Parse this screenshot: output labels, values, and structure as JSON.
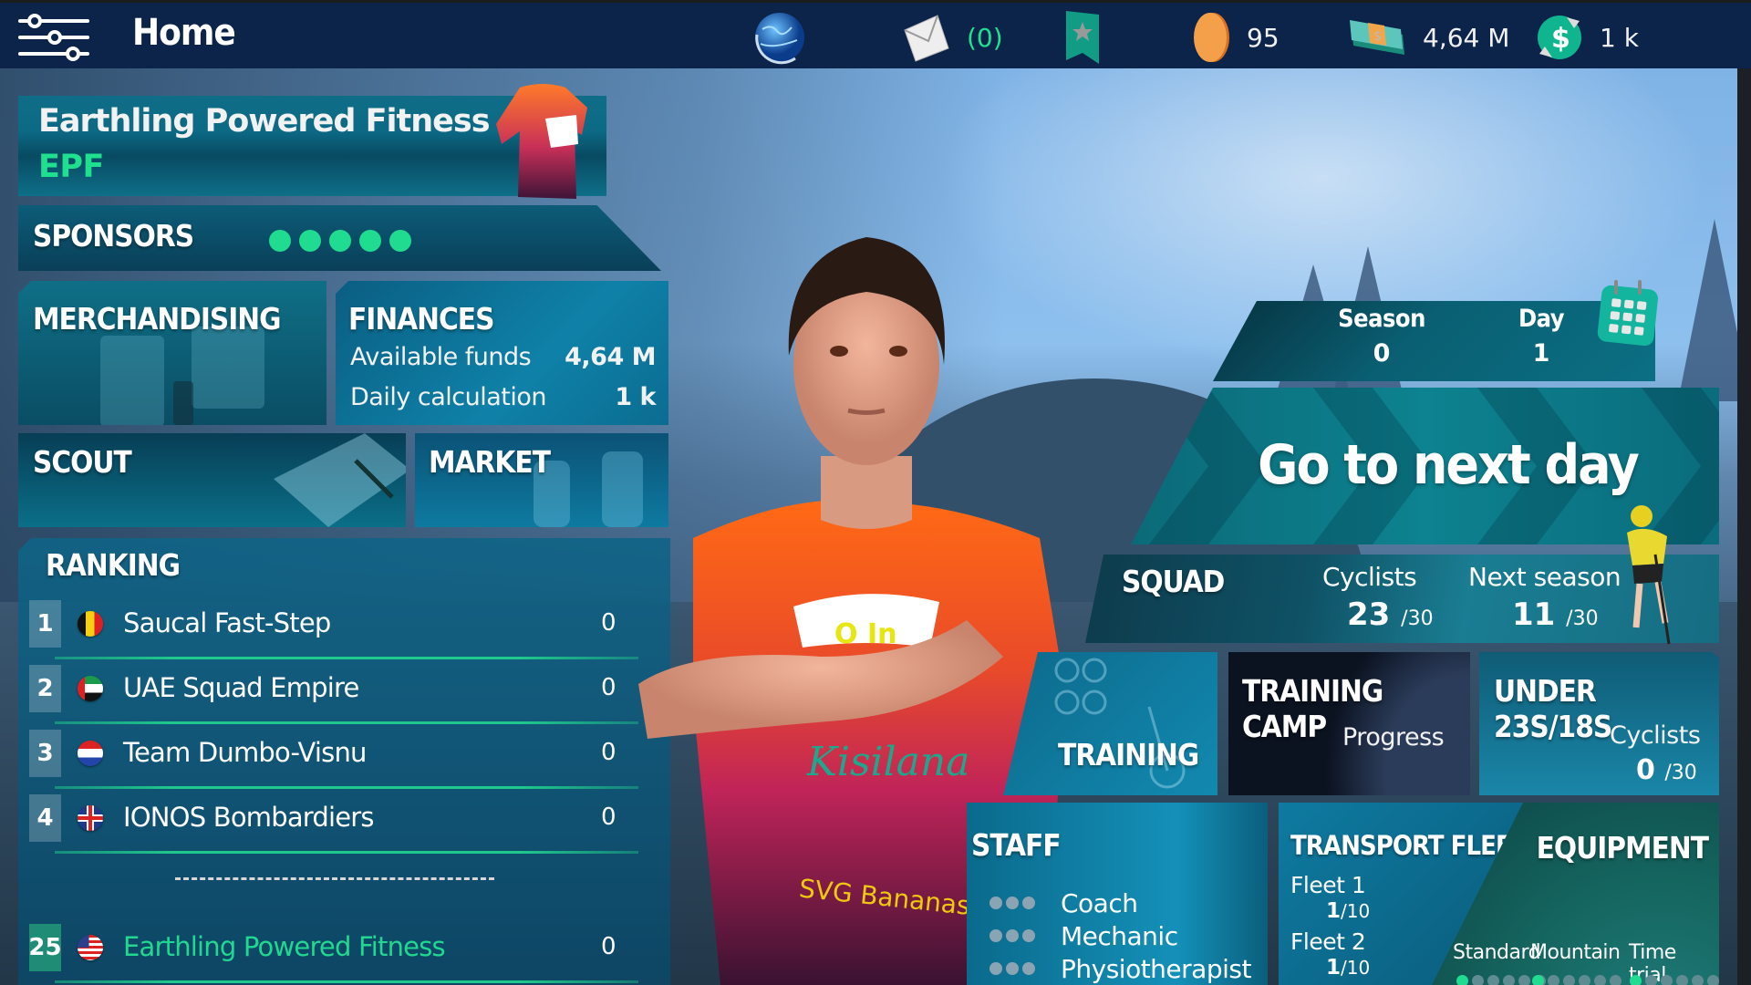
{
  "topbar": {
    "title": "Home",
    "messages_count": "(0)",
    "coins": "95",
    "funds": "4,64 M",
    "daily_income": "1 k",
    "icons": [
      "menu-sliders-icon",
      "globe-icon",
      "envelope-icon",
      "bookmark-star-icon",
      "coin-icon",
      "cash-icon",
      "dollar-exchange-icon"
    ]
  },
  "team": {
    "name": "Earthling Powered Fitness",
    "abbr": "EPF"
  },
  "sponsors": {
    "title": "SPONSORS",
    "rating": 5,
    "max_rating": 5
  },
  "merchandising": {
    "title": "MERCHANDISING"
  },
  "finances": {
    "title": "FINANCES",
    "rows": [
      {
        "label": "Available funds",
        "value": "4,64 M"
      },
      {
        "label": "Daily calculation",
        "value": "1 k"
      }
    ]
  },
  "scout": {
    "title": "SCOUT"
  },
  "market": {
    "title": "MARKET"
  },
  "ranking": {
    "title": "RANKING",
    "rows": [
      {
        "rank": "1",
        "flag": "belgium",
        "team": "Saucal Fast-Step",
        "points": "0"
      },
      {
        "rank": "2",
        "flag": "uae",
        "team": "UAE Squad Empire",
        "points": "0"
      },
      {
        "rank": "3",
        "flag": "netherlands",
        "team": "Team Dumbo-Visnu",
        "points": "0"
      },
      {
        "rank": "4",
        "flag": "uk",
        "team": "IONOS Bombardiers",
        "points": "0"
      }
    ],
    "own": {
      "rank": "25",
      "flag": "usa",
      "team": "Earthling Powered Fitness",
      "points": "0"
    }
  },
  "calendar": {
    "season_label": "Season",
    "season_value": "0",
    "day_label": "Day",
    "day_value": "1"
  },
  "next_day": {
    "label": "Go to next day"
  },
  "squad": {
    "title": "SQUAD",
    "cyclists_label": "Cyclists",
    "cyclists_value": "23",
    "cyclists_max": "/30",
    "next_season_label": "Next season",
    "next_season_value": "11",
    "next_season_max": "/30"
  },
  "training": {
    "title": "TRAINING"
  },
  "training_camp": {
    "title": "TRAINING CAMP",
    "progress_label": "Progress"
  },
  "under23": {
    "title": "UNDER 23S/18S",
    "cyclists_label": "Cyclists",
    "cyclists_value": "0",
    "cyclists_max": "/30"
  },
  "staff": {
    "title": "STAFF",
    "members": [
      {
        "role": "Coach",
        "level": 0,
        "max": 3
      },
      {
        "role": "Mechanic",
        "level": 0,
        "max": 3
      },
      {
        "role": "Physiotherapist",
        "level": 0,
        "max": 3
      }
    ]
  },
  "transport": {
    "title": "TRANSPORT FLEET",
    "fleets": [
      {
        "label": "Fleet 1",
        "value": "1",
        "max": "/10"
      },
      {
        "label": "Fleet 2",
        "value": "1",
        "max": "/10"
      }
    ]
  },
  "equipment": {
    "title": "EQUIPMENT",
    "categories": [
      {
        "label": "Standard",
        "level": 1,
        "max": 6
      },
      {
        "label": "Mountain",
        "level": 1,
        "max": 6
      },
      {
        "label": "Time trial",
        "level": 1,
        "max": 6
      }
    ]
  },
  "colors": {
    "topbar_bg": "#0c244a",
    "accent_green": "#1fdc90",
    "panel_teal": "#0f6d88"
  }
}
